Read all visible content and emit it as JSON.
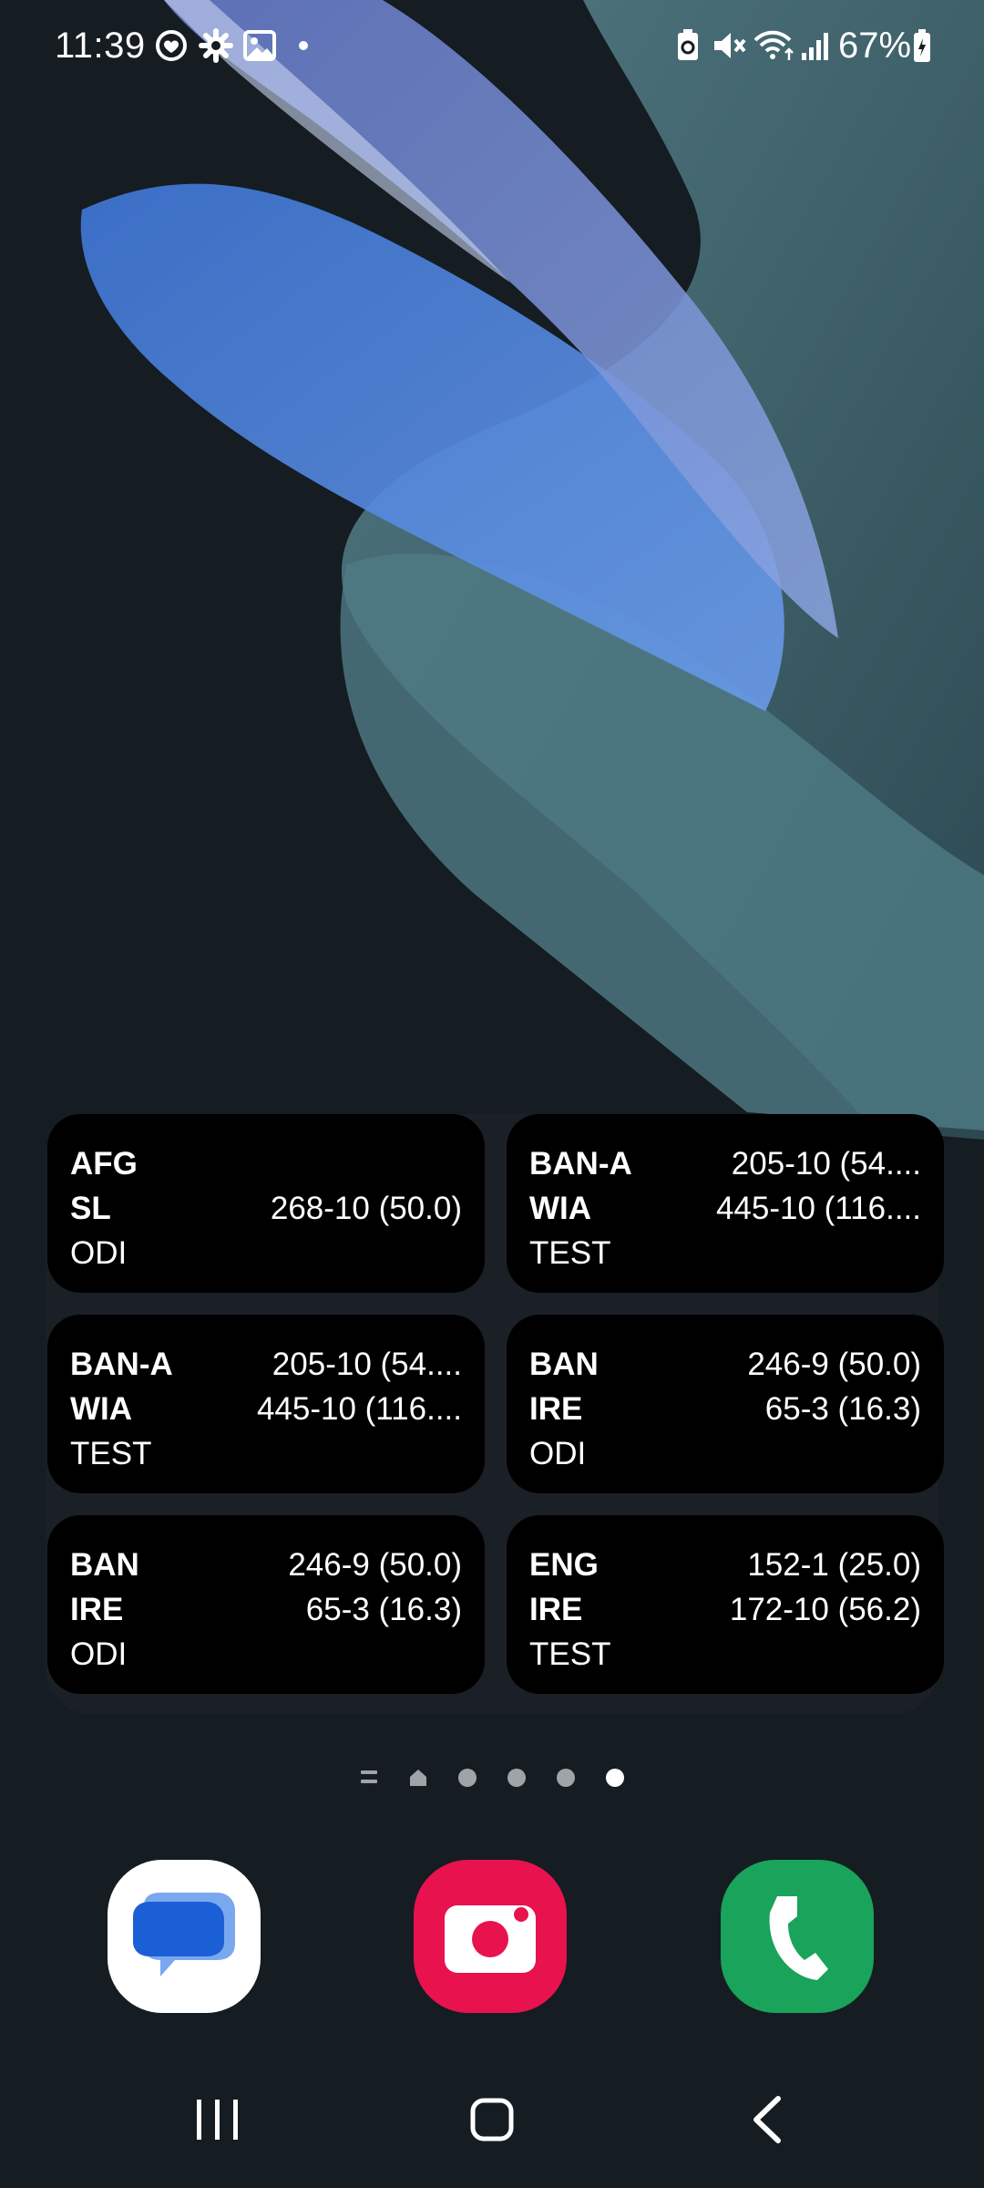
{
  "status_bar": {
    "time": "11:39",
    "battery_percent": "67%",
    "icons_left": [
      "health-icon",
      "settings-gear-icon",
      "gallery-icon",
      "notification-dot-icon"
    ],
    "icons_right": [
      "battery-saver-icon",
      "mute-icon",
      "wifi-icon",
      "signal-icon",
      "battery-icon"
    ]
  },
  "widget": {
    "cards": [
      {
        "team1": "AFG",
        "score1": "",
        "team2": "SL",
        "score2": "268-10 (50.0)",
        "format": "ODI"
      },
      {
        "team1": "BAN-A",
        "score1": "205-10 (54....",
        "team2": "WIA",
        "score2": "445-10 (116....",
        "format": "TEST"
      },
      {
        "team1": "BAN-A",
        "score1": "205-10 (54....",
        "team2": "WIA",
        "score2": "445-10 (116....",
        "format": "TEST"
      },
      {
        "team1": "BAN",
        "score1": "246-9 (50.0)",
        "team2": "IRE",
        "score2": "65-3 (16.3)",
        "format": "ODI"
      },
      {
        "team1": "BAN",
        "score1": "246-9 (50.0)",
        "team2": "IRE",
        "score2": "65-3 (16.3)",
        "format": "ODI"
      },
      {
        "team1": "ENG",
        "score1": "152-1 (25.0)",
        "team2": "IRE",
        "score2": "172-10 (56.2)",
        "format": "TEST"
      }
    ]
  },
  "page_indicator": {
    "pages": [
      "menu-icon",
      "home-icon",
      "dot",
      "dot",
      "dot",
      "dot"
    ],
    "active_index": 5
  },
  "dock": {
    "apps": [
      "messages-app-icon",
      "camera-app-icon",
      "phone-app-icon"
    ]
  },
  "nav_bar": {
    "buttons": [
      "recents-icon",
      "home-icon",
      "back-icon"
    ]
  },
  "colors": {
    "background": "#151c22",
    "widget_bg": "#1a2026",
    "card_bg": "#000000",
    "camera_red": "#e8124e",
    "phone_green": "#1aa35a",
    "messages_blue": "#1a5fd6"
  }
}
